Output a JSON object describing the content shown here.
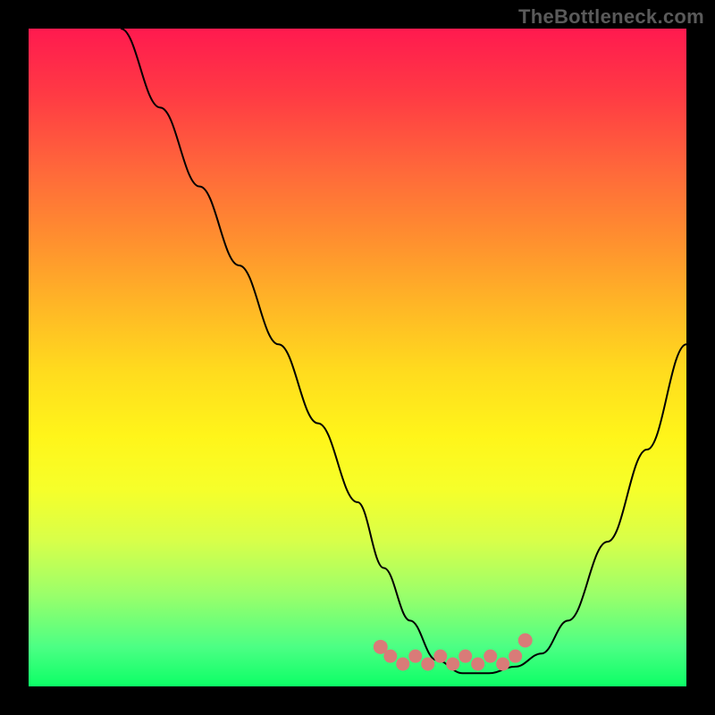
{
  "watermark": "TheBottleneck.com",
  "chart_data": {
    "type": "line",
    "title": "",
    "xlabel": "",
    "ylabel": "",
    "xlim": [
      0,
      100
    ],
    "ylim": [
      0,
      100
    ],
    "grid": false,
    "series": [
      {
        "name": "bottleneck-curve",
        "x": [
          14,
          20,
          26,
          32,
          38,
          44,
          50,
          54,
          58,
          62,
          66,
          70,
          74,
          78,
          82,
          88,
          94,
          100
        ],
        "values": [
          100,
          88,
          76,
          64,
          52,
          40,
          28,
          18,
          10,
          4,
          2,
          2,
          3,
          5,
          10,
          22,
          36,
          52
        ],
        "color": "#000000",
        "stroke_width": 2
      }
    ],
    "annotations": [
      {
        "name": "optimal-zone-marker",
        "type": "scatter-band",
        "x_range": [
          55,
          74
        ],
        "y_level": 4,
        "color": "#d97b78"
      }
    ],
    "background_gradient": {
      "orientation": "vertical",
      "stops": [
        {
          "pos": 0.0,
          "color": "#ff1a4f"
        },
        {
          "pos": 0.5,
          "color": "#ffdb1e"
        },
        {
          "pos": 1.0,
          "color": "#0cff66"
        }
      ]
    }
  }
}
